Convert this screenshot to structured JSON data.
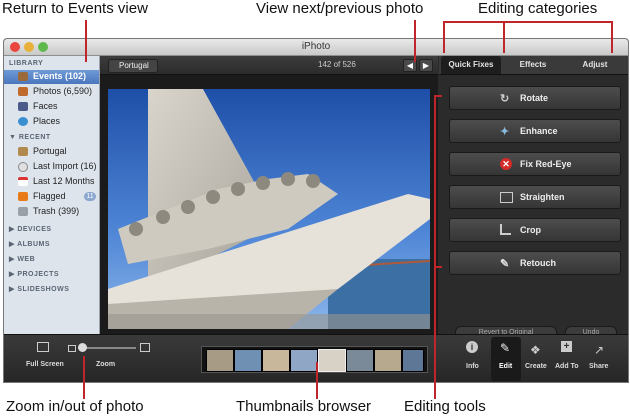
{
  "callouts": {
    "return_events": "Return to Events view",
    "view_next_prev": "View next/previous photo",
    "editing_categories": "Editing categories",
    "zoom": "Zoom in/out of photo",
    "thumbnails": "Thumbnails browser",
    "editing_tools": "Editing tools"
  },
  "window": {
    "title": "iPhoto"
  },
  "sidebar": {
    "library_header": "LIBRARY",
    "library": [
      {
        "label": "Events (102)",
        "icon": "events-icon",
        "selected": true
      },
      {
        "label": "Photos (6,590)",
        "icon": "photos-icon"
      },
      {
        "label": "Faces",
        "icon": "faces-icon"
      },
      {
        "label": "Places",
        "icon": "places-icon"
      }
    ],
    "recent_header": "RECENT",
    "recent": [
      {
        "label": "Portugal",
        "icon": "event-icon"
      },
      {
        "label": "Last Import (16)",
        "icon": "import-icon"
      },
      {
        "label": "Last 12 Months",
        "icon": "calendar-icon"
      },
      {
        "label": "Flagged",
        "icon": "flag-icon",
        "badge": "11"
      },
      {
        "label": "Trash (399)",
        "icon": "trash-icon"
      }
    ],
    "sections": [
      "DEVICES",
      "ALBUMS",
      "WEB",
      "PROJECTS",
      "SLIDESHOWS"
    ]
  },
  "viewer": {
    "back_button": "Portugal",
    "counter": "142 of 526"
  },
  "panel": {
    "tabs": [
      "Quick Fixes",
      "Effects",
      "Adjust"
    ],
    "tools": [
      {
        "label": "Rotate",
        "icon": "rotate-icon"
      },
      {
        "label": "Enhance",
        "icon": "enhance-icon"
      },
      {
        "label": "Fix Red-Eye",
        "icon": "red-eye-icon"
      },
      {
        "label": "Straighten",
        "icon": "straighten-icon"
      },
      {
        "label": "Crop",
        "icon": "crop-icon"
      },
      {
        "label": "Retouch",
        "icon": "retouch-icon"
      }
    ],
    "revert": "Revert to Original",
    "undo": "Undo"
  },
  "bottom": {
    "full_screen": "Full Screen",
    "zoom": "Zoom",
    "buttons": [
      "Info",
      "Edit",
      "Create",
      "Add To",
      "Share"
    ]
  },
  "colors": {
    "accent_red": "#c0252b",
    "selection_blue": "#4a76bd"
  }
}
